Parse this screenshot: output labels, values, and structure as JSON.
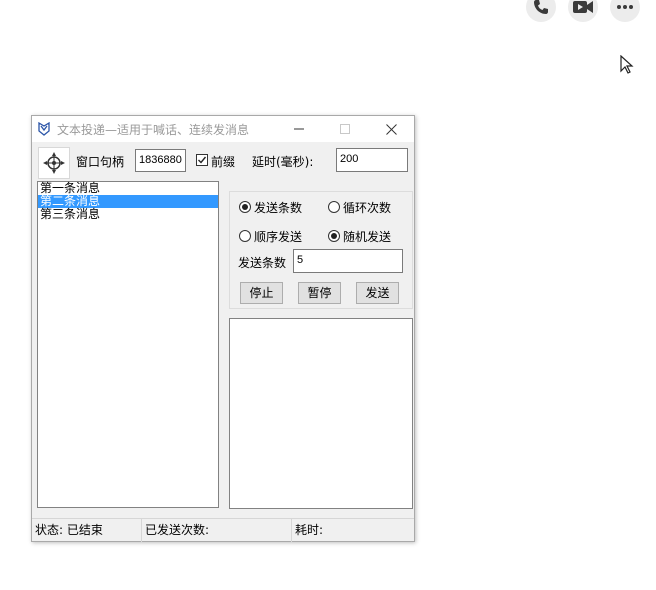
{
  "host": {
    "icons": [
      "phone-icon",
      "video-camera-icon",
      "more-icon"
    ]
  },
  "window": {
    "title": "文本投递—适用于喊话、连续发消息",
    "controls": [
      "minimize",
      "maximize",
      "close"
    ]
  },
  "toolbar": {
    "handle_label": "窗口句柄",
    "handle_value": "1836880",
    "prefix_label": "前缀",
    "prefix_checked": true,
    "delay_label": "延时(毫秒):",
    "delay_value": "200"
  },
  "messages": [
    {
      "text": "第一条消息",
      "selected": false
    },
    {
      "text": "第二条消息",
      "selected": true
    },
    {
      "text": "第三条消息",
      "selected": false
    }
  ],
  "options": {
    "mode_count": {
      "label": "发送条数",
      "checked": true
    },
    "mode_loop": {
      "label": "循环次数",
      "checked": false
    },
    "order_seq": {
      "label": "顺序发送",
      "checked": false
    },
    "order_rand": {
      "label": "随机发送",
      "checked": true
    },
    "count_label": "发送条数",
    "count_value": "5"
  },
  "buttons": {
    "stop": "停止",
    "pause": "暂停",
    "send": "发送"
  },
  "status": {
    "state": "状态: 已结束",
    "sent": "已发送次数:",
    "elapsed": "耗时:"
  },
  "colors": {
    "selection": "#3399ff",
    "window_bg": "#f0f0f0"
  }
}
